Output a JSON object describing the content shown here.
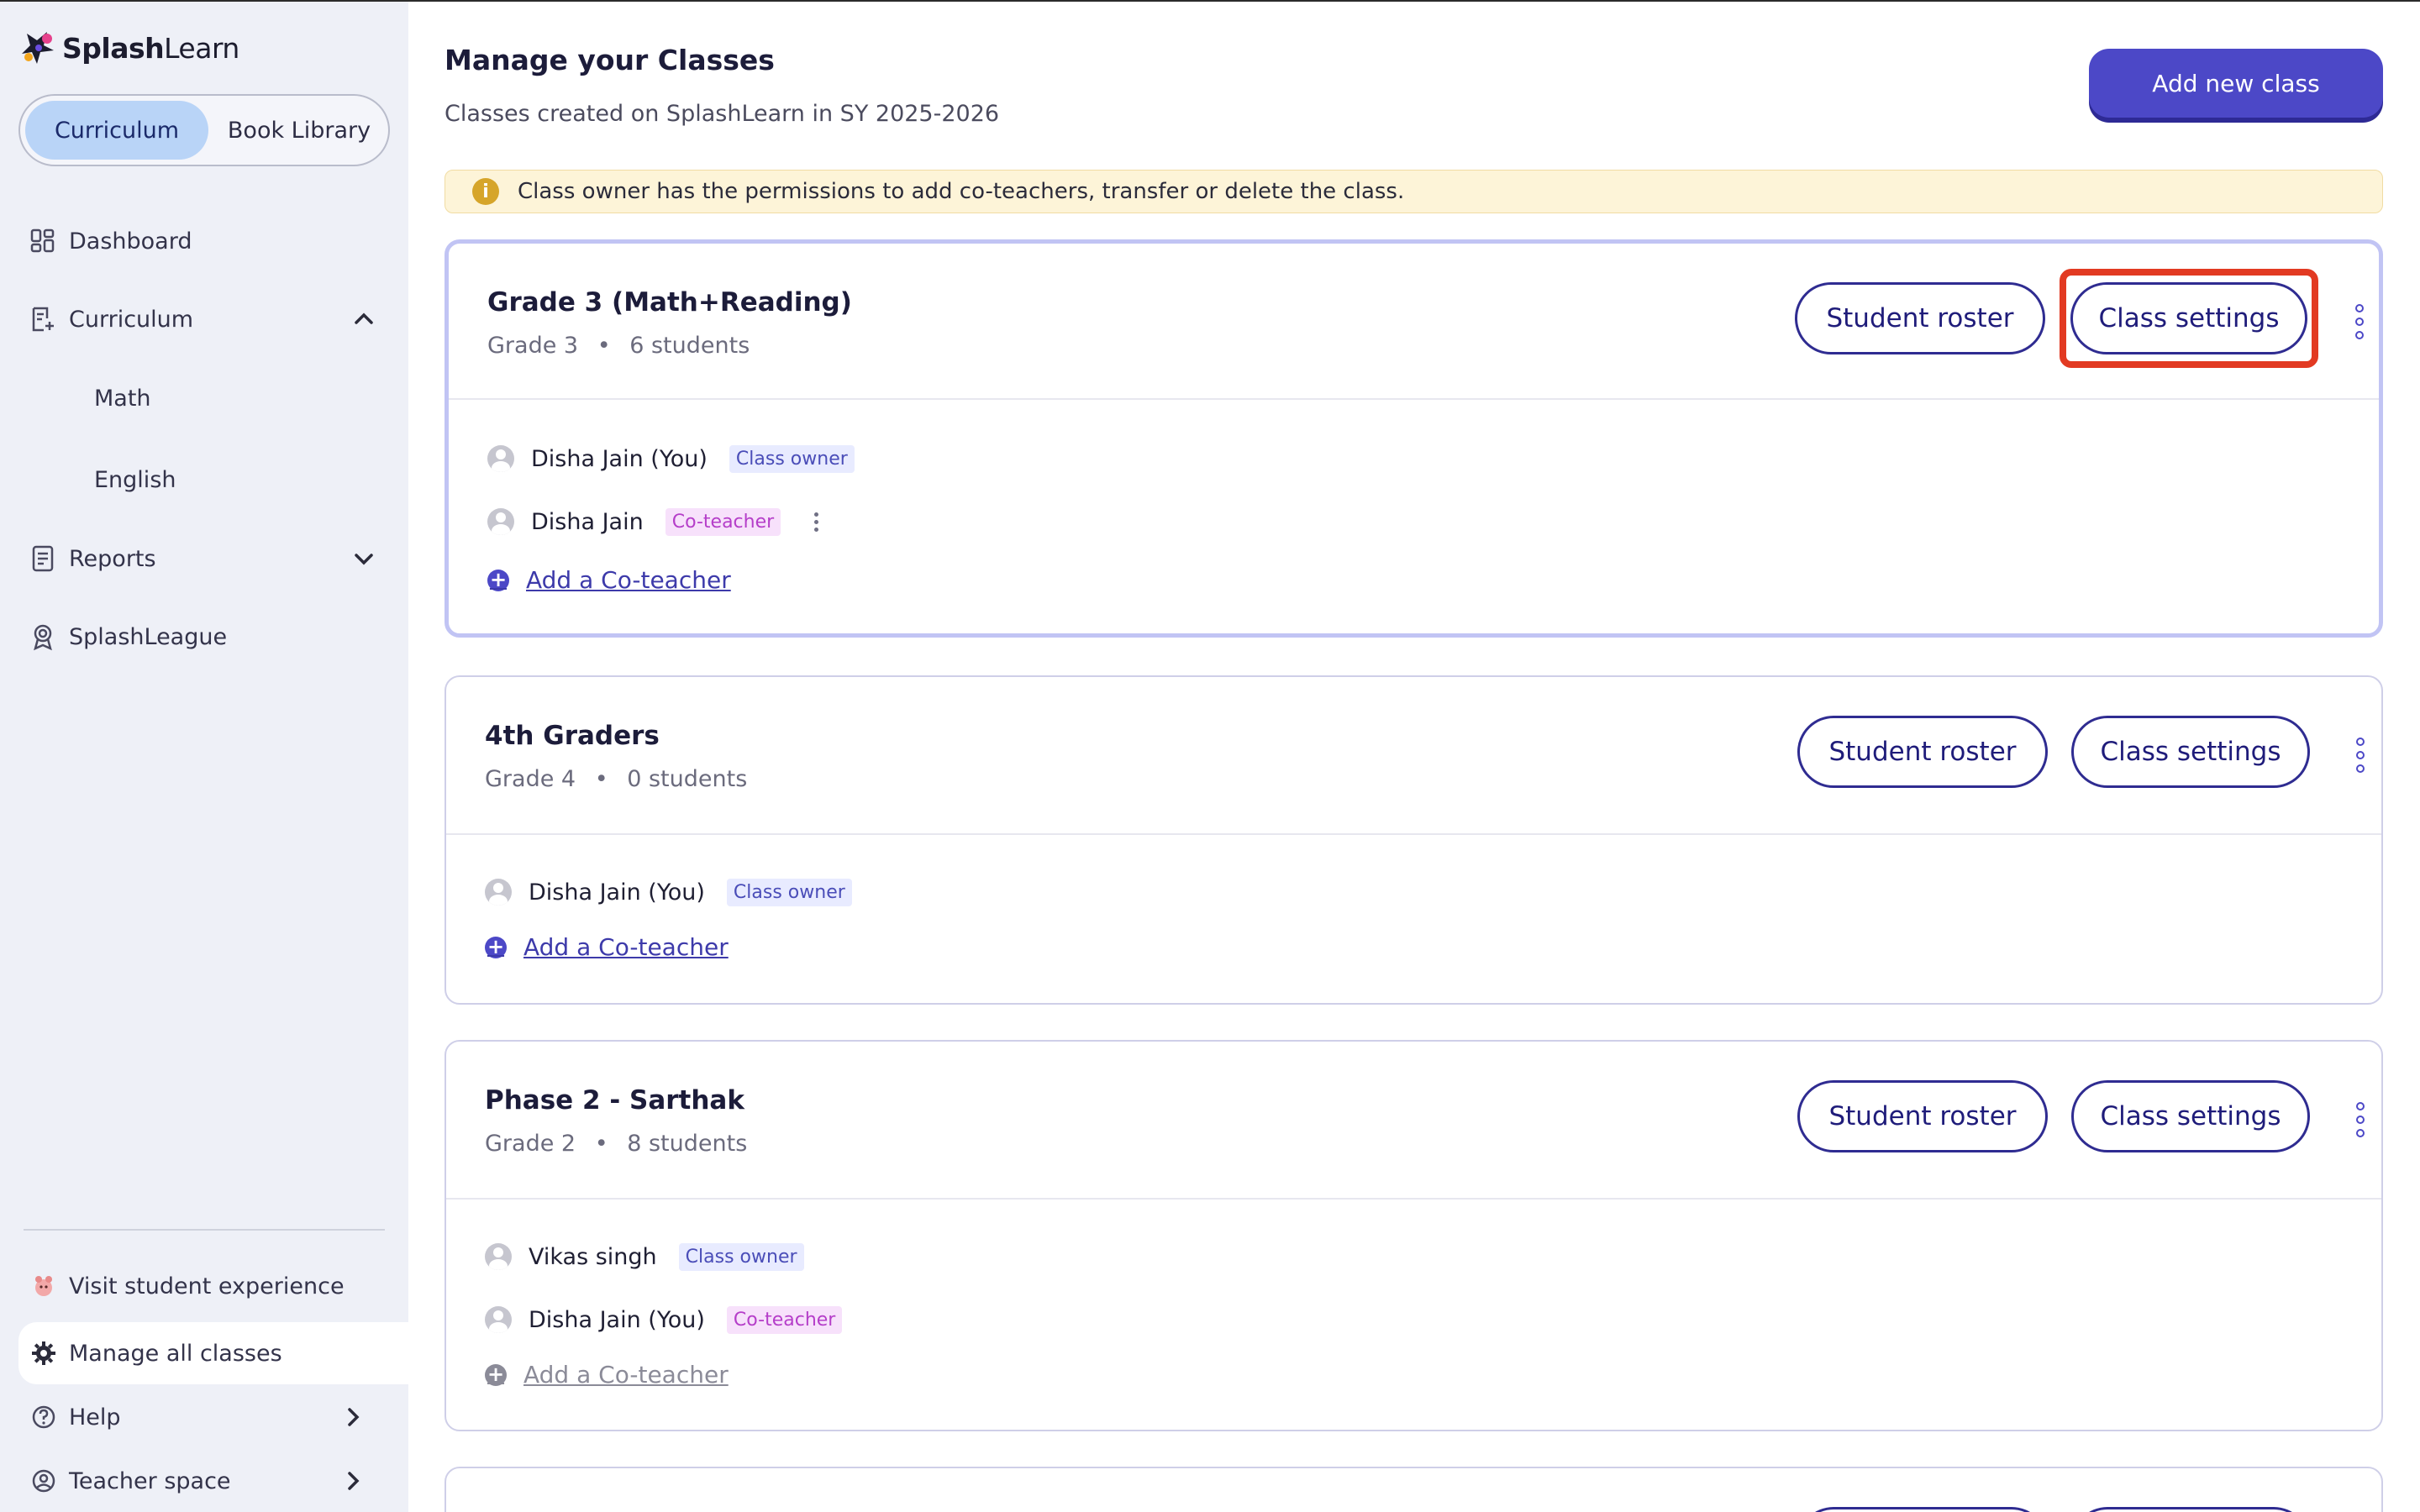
{
  "app": {
    "brand_bold": "Splash",
    "brand_light": "Learn"
  },
  "sidebar": {
    "toggle": {
      "active": "Curriculum",
      "inactive": "Book Library"
    },
    "nav": {
      "dashboard": "Dashboard",
      "curriculum": "Curriculum",
      "math": "Math",
      "english": "English",
      "reports": "Reports",
      "splashleague": "SplashLeague"
    },
    "bottom": {
      "visit": "Visit student experience",
      "manage": "Manage all classes",
      "help": "Help",
      "teacher_space": "Teacher space"
    }
  },
  "main": {
    "title": "Manage your Classes",
    "subtitle": "Classes created on SplashLearn in SY 2025-2026",
    "add_class": "Add new class",
    "info": "Class owner has the permissions to add co-teachers, transfer or delete the class."
  },
  "classes": [
    {
      "name": "Grade 3 (Math+Reading)",
      "grade": "Grade 3",
      "students": "6 students",
      "roster": "Student roster",
      "settings": "Class settings",
      "members": [
        {
          "name": "Disha Jain (You)",
          "role": "Class owner"
        },
        {
          "name": "Disha Jain",
          "role": "Co-teacher"
        }
      ],
      "add": "Add a Co-teacher"
    },
    {
      "name": "4th Graders",
      "grade": "Grade 4",
      "students": "0 students",
      "roster": "Student roster",
      "settings": "Class settings",
      "members": [
        {
          "name": "Disha Jain (You)",
          "role": "Class owner"
        }
      ],
      "add": "Add a Co-teacher"
    },
    {
      "name": "Phase 2 - Sarthak",
      "grade": "Grade 2",
      "students": "8 students",
      "roster": "Student roster",
      "settings": "Class settings",
      "members": [
        {
          "name": "Vikas singh",
          "role": "Class owner"
        },
        {
          "name": "Disha Jain (You)",
          "role": "Co-teacher"
        }
      ],
      "add": "Add a Co-teacher"
    }
  ],
  "colors": {
    "accent": "#4c48c7",
    "highlight": "#e23a22",
    "sidebar_bg": "#eef0f7"
  }
}
